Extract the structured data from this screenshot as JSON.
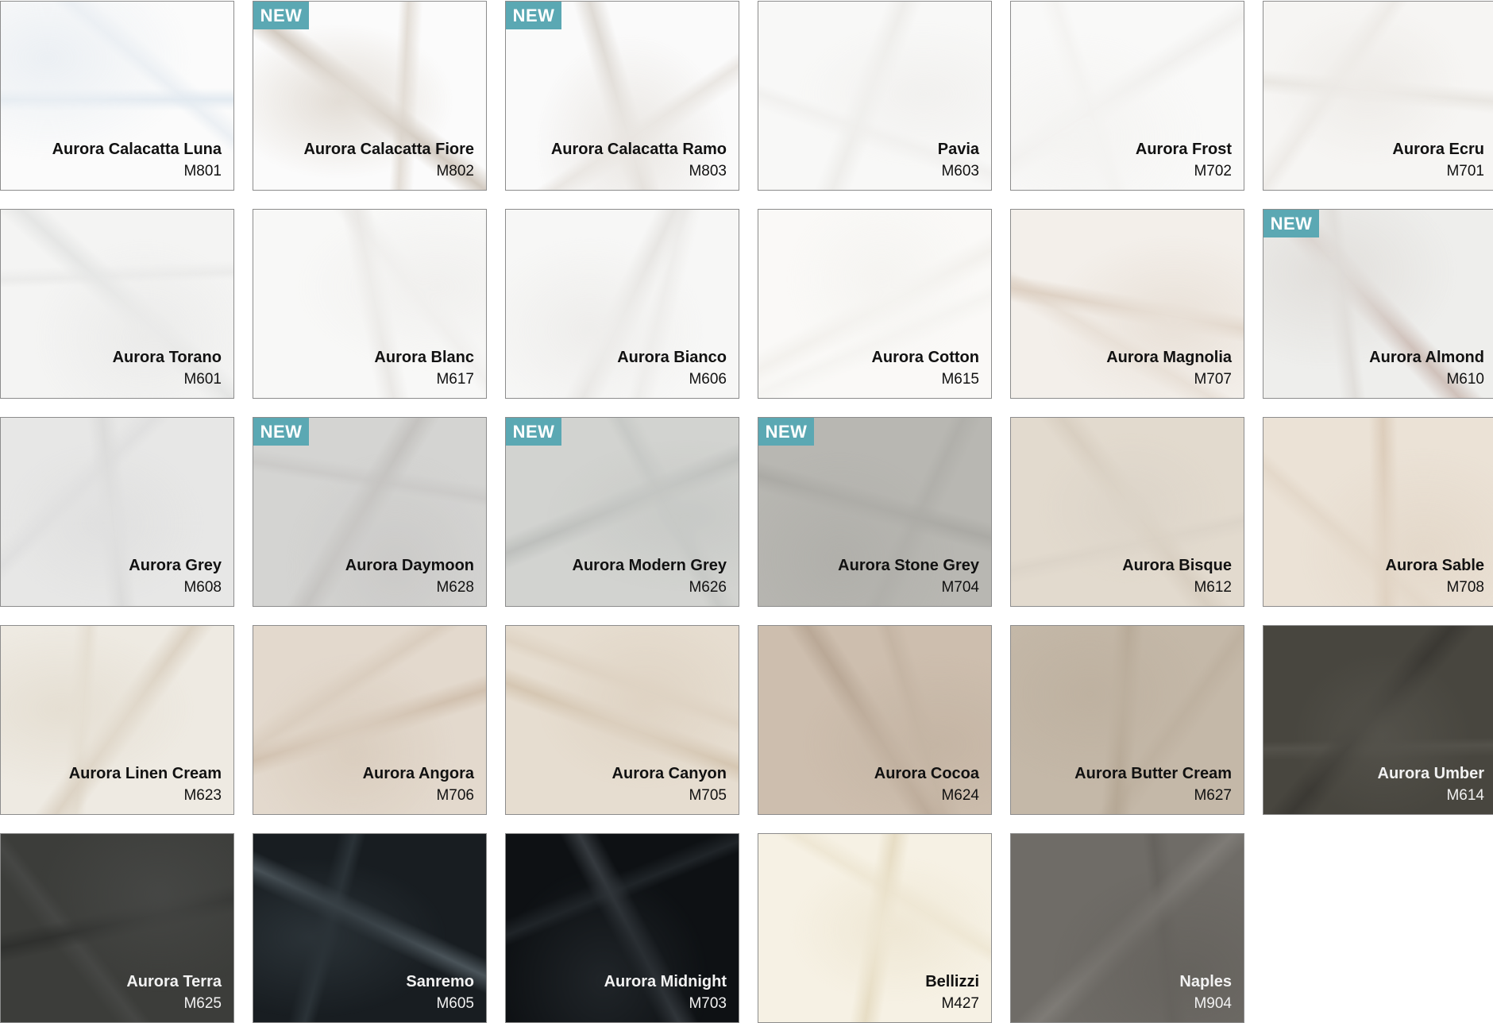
{
  "badge_text": "NEW",
  "colors": {
    "badge": "#5ba8b3",
    "border": "#8c8c8c"
  },
  "swatches": [
    {
      "name": "Aurora Calacatta Luna",
      "code": "M801",
      "new": false,
      "base": "#fbfbfb",
      "veins": [
        "#dde6ee",
        "#e8edf2"
      ],
      "dark": false
    },
    {
      "name": "Aurora Calacatta Fiore",
      "code": "M802",
      "new": true,
      "base": "#fbfbfb",
      "veins": [
        "#c9bfb3",
        "#ddd6cd"
      ],
      "dark": false
    },
    {
      "name": "Aurora Calacatta Ramo",
      "code": "M803",
      "new": true,
      "base": "#fafafa",
      "veins": [
        "#d8d3cc",
        "#e6e2dd"
      ],
      "dark": false
    },
    {
      "name": "Pavia",
      "code": "M603",
      "new": false,
      "base": "#f8f8f7",
      "veins": [
        "#ecebe8",
        "#f0efed"
      ],
      "dark": false
    },
    {
      "name": "Aurora Frost",
      "code": "M702",
      "new": false,
      "base": "#f9f9f8",
      "veins": [
        "#efeeec",
        "#f3f2f0"
      ],
      "dark": false
    },
    {
      "name": "Aurora Ecru",
      "code": "M701",
      "new": false,
      "base": "#f6f5f3",
      "veins": [
        "#e6e3de",
        "#ece9e5"
      ],
      "dark": false
    },
    {
      "name": "Aurora Torano",
      "code": "M601",
      "new": false,
      "base": "#f4f4f3",
      "veins": [
        "#e1e2e1",
        "#e9e9e8"
      ],
      "dark": false
    },
    {
      "name": "Aurora Blanc",
      "code": "M617",
      "new": false,
      "base": "#f8f8f7",
      "veins": [
        "#e7e5e2",
        "#efeeec"
      ],
      "dark": false
    },
    {
      "name": "Aurora Bianco",
      "code": "M606",
      "new": false,
      "base": "#f7f7f6",
      "veins": [
        "#e3e1de",
        "#ecebe9"
      ],
      "dark": false
    },
    {
      "name": "Aurora Cotton",
      "code": "M615",
      "new": false,
      "base": "#faf9f7",
      "veins": [
        "#f1efeb",
        "#f4f3f0"
      ],
      "dark": false
    },
    {
      "name": "Aurora Magnolia",
      "code": "M707",
      "new": false,
      "base": "#f3efea",
      "veins": [
        "#d9cabb",
        "#e6ddd3"
      ],
      "dark": false
    },
    {
      "name": "Aurora Almond",
      "code": "M610",
      "new": true,
      "base": "#eeeeec",
      "veins": [
        "#c8b6ae",
        "#dedbd7"
      ],
      "dark": false
    },
    {
      "name": "Aurora Grey",
      "code": "M608",
      "new": false,
      "base": "#e7e7e6",
      "veins": [
        "#d9d9d8",
        "#dedede"
      ],
      "dark": false
    },
    {
      "name": "Aurora Daymoon",
      "code": "M628",
      "new": true,
      "base": "#d4d4d2",
      "veins": [
        "#c0bebb",
        "#c9c8c6"
      ],
      "dark": false
    },
    {
      "name": "Aurora Modern Grey",
      "code": "M626",
      "new": true,
      "base": "#d2d3d0",
      "veins": [
        "#b9bbb8",
        "#c5c7c4"
      ],
      "dark": false
    },
    {
      "name": "Aurora Stone Grey",
      "code": "M704",
      "new": true,
      "base": "#b8b7b2",
      "veins": [
        "#a8a7a2",
        "#afaea9"
      ],
      "dark": false
    },
    {
      "name": "Aurora Bisque",
      "code": "M612",
      "new": false,
      "base": "#e2dace",
      "veins": [
        "#d6ccbe",
        "#dbd3c7"
      ],
      "dark": false
    },
    {
      "name": "Aurora Sable",
      "code": "M708",
      "new": false,
      "base": "#ebe2d6",
      "veins": [
        "#d9c8b5",
        "#e2d6c7"
      ],
      "dark": false
    },
    {
      "name": "Aurora Linen Cream",
      "code": "M623",
      "new": false,
      "base": "#eeeae2",
      "veins": [
        "#d8cdbd",
        "#e3dccf"
      ],
      "dark": false
    },
    {
      "name": "Aurora Angora",
      "code": "M706",
      "new": false,
      "base": "#e3d9cd",
      "veins": [
        "#cdbba8",
        "#d8cbbc"
      ],
      "dark": false
    },
    {
      "name": "Aurora Canyon",
      "code": "M705",
      "new": false,
      "base": "#e6ddd0",
      "veins": [
        "#d1c1ab",
        "#ddd1c1"
      ],
      "dark": false
    },
    {
      "name": "Aurora Cocoa",
      "code": "M624",
      "new": false,
      "base": "#cdbeae",
      "veins": [
        "#b5a391",
        "#c3b3a2"
      ],
      "dark": false
    },
    {
      "name": "Aurora Butter Cream",
      "code": "M627",
      "new": false,
      "base": "#c4b8a8",
      "veins": [
        "#b3a592",
        "#bdb09f"
      ],
      "dark": false
    },
    {
      "name": "Aurora Umber",
      "code": "M614",
      "new": false,
      "base": "#48463f",
      "veins": [
        "#3a3833",
        "#55534c"
      ],
      "dark": true
    },
    {
      "name": "Aurora Terra",
      "code": "M625",
      "new": false,
      "base": "#3c3d3a",
      "veins": [
        "#2e2f2d",
        "#474846"
      ],
      "dark": true
    },
    {
      "name": "Sanremo",
      "code": "M605",
      "new": false,
      "base": "#181d21",
      "veins": [
        "#505a60",
        "#2d353a"
      ],
      "dark": true
    },
    {
      "name": "Aurora Midnight",
      "code": "M703",
      "new": false,
      "base": "#0e1114",
      "veins": [
        "#3a3f44",
        "#22272b"
      ],
      "dark": true
    },
    {
      "name": "Bellizzi",
      "code": "M427",
      "new": false,
      "base": "#f6f1e4",
      "veins": [
        "#e3d8bd",
        "#ede5d1"
      ],
      "dark": false
    },
    {
      "name": "Naples",
      "code": "M904",
      "new": false,
      "base": "#6f6c67",
      "veins": [
        "#807d78",
        "#65625d"
      ],
      "dark": true
    }
  ]
}
